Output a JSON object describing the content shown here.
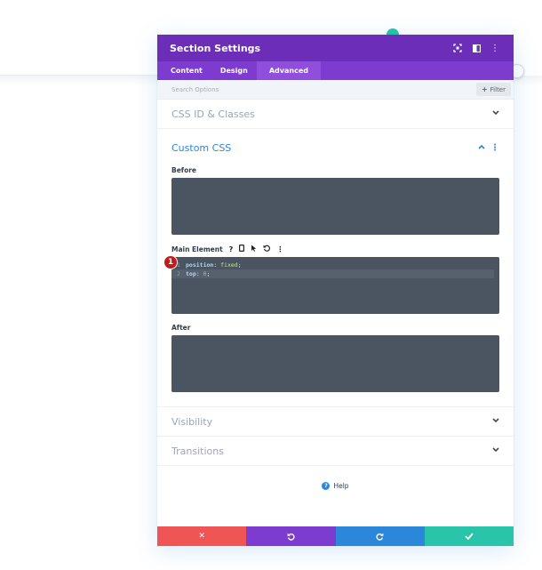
{
  "header": {
    "title": "Section Settings"
  },
  "tabs": [
    {
      "label": "Content",
      "active": false
    },
    {
      "label": "Design",
      "active": false
    },
    {
      "label": "Advanced",
      "active": true
    }
  ],
  "search": {
    "placeholder": "Search Options",
    "filter_label": "Filter"
  },
  "sections": {
    "css_id": {
      "label": "CSS ID & Classes"
    },
    "custom_css": {
      "label": "Custom CSS",
      "before_label": "Before",
      "main_element_label": "Main Element",
      "after_label": "After",
      "code_lines": [
        {
          "num": "1",
          "prop": "position",
          "value": "fixed"
        },
        {
          "num": "2",
          "prop": "top",
          "value": "0"
        }
      ]
    },
    "visibility": {
      "label": "Visibility"
    },
    "transitions": {
      "label": "Transitions"
    }
  },
  "annotation": {
    "badge": "1"
  },
  "help": {
    "label": "Help"
  },
  "footer": {
    "colors": {
      "cancel": "#ef5555",
      "undo": "#7e3bd0",
      "redo": "#2b87da",
      "save": "#29c4a9"
    }
  },
  "colors": {
    "header": "#6c2eb9",
    "tabs": "#7d3bcf",
    "accent": "#2b87da",
    "code_bg": "#4a5561"
  },
  "icons": [
    "expand-icon",
    "columns-icon",
    "more-vertical-icon",
    "chevron-down-icon",
    "chevron-up-icon",
    "question-icon",
    "mobile-icon",
    "cursor-icon",
    "undo-icon",
    "close-icon",
    "redo-icon",
    "check-icon",
    "help-icon"
  ]
}
